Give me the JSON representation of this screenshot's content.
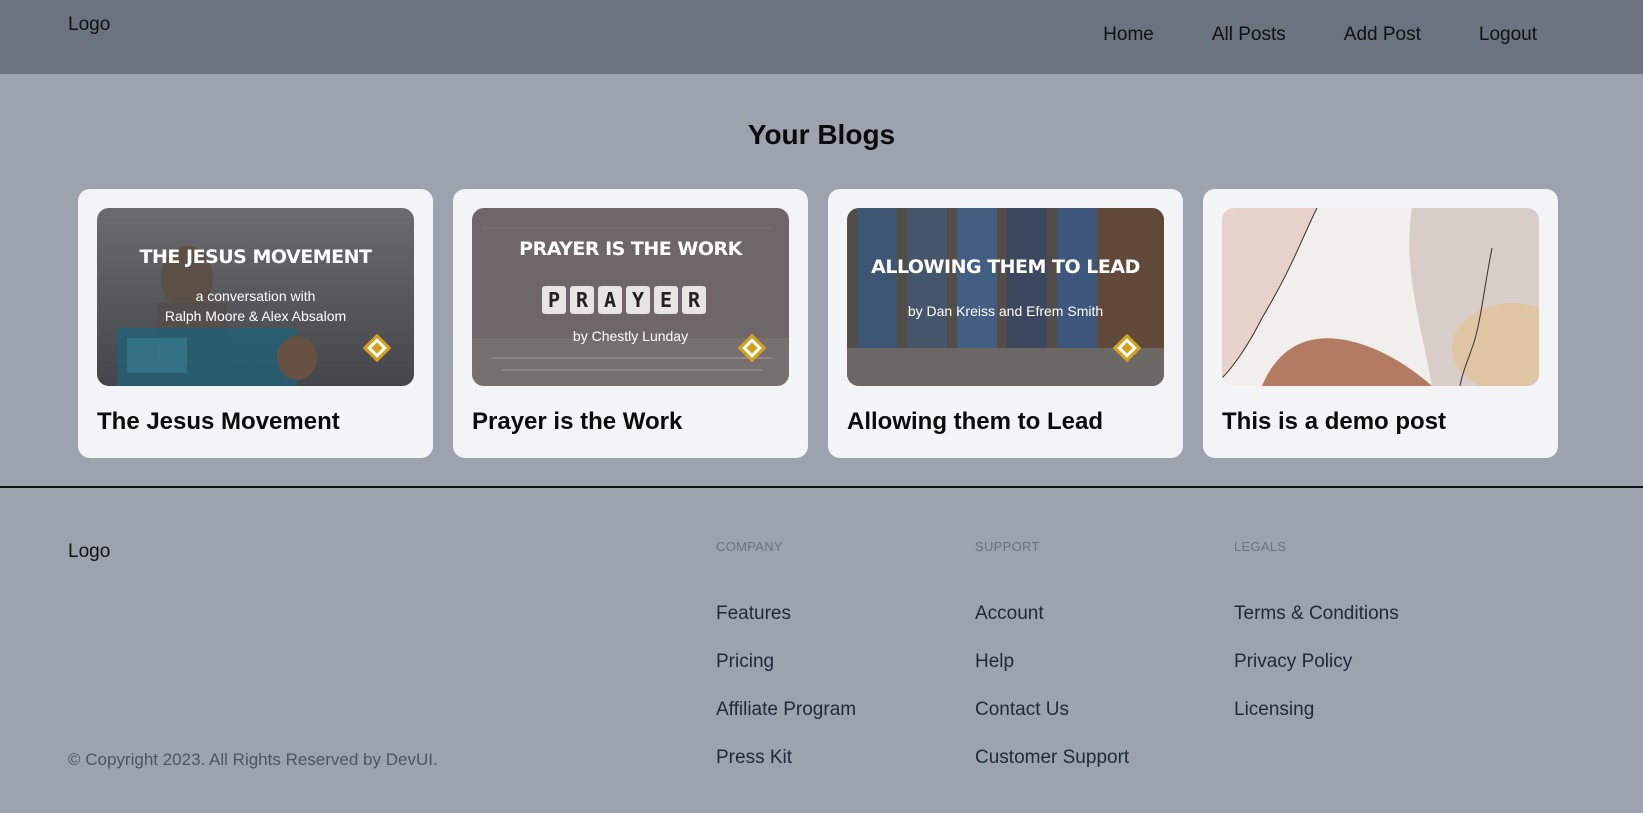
{
  "navbar": {
    "logo": "Logo",
    "links": [
      "Home",
      "All Posts",
      "Add Post",
      "Logout"
    ]
  },
  "page_title": "Your Blogs",
  "cards": [
    {
      "title": "The Jesus Movement",
      "thumb_heading": "THE JESUS MOVEMENT",
      "thumb_line1": "a conversation with",
      "thumb_line2": "Ralph Moore & Alex Absalom"
    },
    {
      "title": "Prayer is the Work",
      "thumb_heading": "PRAYER IS THE WORK",
      "thumb_tiles": [
        "P",
        "R",
        "A",
        "Y",
        "E",
        "R"
      ],
      "thumb_line1": "by Chestly Lunday"
    },
    {
      "title": "Allowing them to Lead",
      "thumb_heading": "ALLOWING THEM TO LEAD",
      "thumb_line1": "by Dan Kreiss and Efrem Smith"
    },
    {
      "title": "This is a demo post"
    }
  ],
  "footer": {
    "logo": "Logo",
    "columns": [
      {
        "heading": "COMPANY",
        "items": [
          "Features",
          "Pricing",
          "Affiliate Program",
          "Press Kit"
        ]
      },
      {
        "heading": "SUPPORT",
        "items": [
          "Account",
          "Help",
          "Contact Us",
          "Customer Support"
        ]
      },
      {
        "heading": "LEGALS",
        "items": [
          "Terms & Conditions",
          "Privacy Policy",
          "Licensing"
        ]
      }
    ],
    "copyright": "© Copyright 2023. All Rights Reserved by DevUI."
  },
  "colors": {
    "navbar_bg": "#6b7280",
    "page_bg": "#9ca3af",
    "card_bg": "#f3f4f6",
    "badge_gold": "#d4a017"
  }
}
